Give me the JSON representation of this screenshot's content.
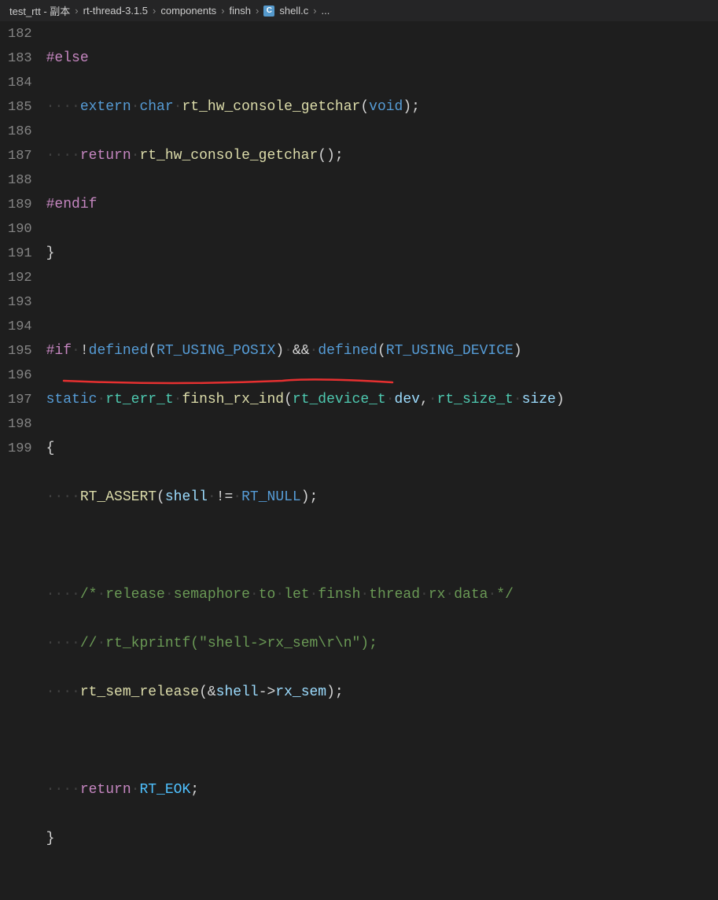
{
  "breadcrumb": {
    "parts": [
      "test_rtt - 副本",
      "rt-thread-3.1.5",
      "components",
      "finsh",
      "shell.c",
      "..."
    ]
  },
  "lines": {
    "start": 182,
    "end": 199
  },
  "code": {
    "l182": "#else",
    "l183_extern": "extern",
    "l183_char": "char",
    "l183_fn": "rt_hw_console_getchar",
    "l183_void": "void",
    "l184_return": "return",
    "l184_fn": "rt_hw_console_getchar",
    "l185": "#endif",
    "l186_brace": "}",
    "l188_if": "#if",
    "l188_not": "!",
    "l188_defined1": "defined",
    "l188_posix": "RT_USING_POSIX",
    "l188_and": "&&",
    "l188_defined2": "defined",
    "l188_device": "RT_USING_DEVICE",
    "l189_static": "static",
    "l189_type": "rt_err_t",
    "l189_fn": "finsh_rx_ind",
    "l189_p1t": "rt_device_t",
    "l189_p1n": "dev",
    "l189_p2t": "rt_size_t",
    "l189_p2n": "size",
    "l190_brace": "{",
    "l191_fn": "RT_ASSERT",
    "l191_var": "shell",
    "l191_null": "RT_NULL",
    "l193_comment": "/* release semaphore to let finsh thread rx data */",
    "l194_comment": "// rt_kprintf(\"shell->rx_sem\\r\\n\");",
    "l195_fn": "rt_sem_release",
    "l195_var": "shell",
    "l195_mem": "rx_sem",
    "l197_return": "return",
    "l197_const": "RT_EOK",
    "l198_brace": "}"
  }
}
